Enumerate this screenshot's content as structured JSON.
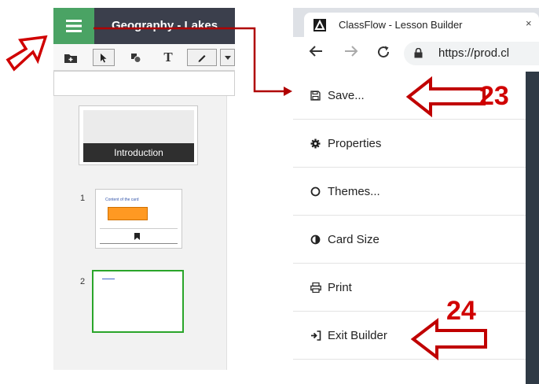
{
  "left_app": {
    "title": "Geography - Lakes",
    "toolbar": {
      "text_tool_label": "T"
    },
    "intro_card": {
      "label": "Introduction"
    },
    "cards": [
      {
        "number": "1",
        "title": "Content of the card"
      },
      {
        "number": "2"
      }
    ]
  },
  "browser": {
    "tab_title": "ClassFlow - Lesson Builder",
    "tab_close": "×",
    "url": "https://prod.cl"
  },
  "menu": {
    "items": [
      {
        "label": "Save...",
        "icon": "floppy-disk-icon"
      },
      {
        "label": "Properties",
        "icon": "gear-icon"
      },
      {
        "label": "Themes...",
        "icon": "circle-outline-icon"
      },
      {
        "label": "Card Size",
        "icon": "half-circle-icon"
      },
      {
        "label": "Print",
        "icon": "printer-icon"
      },
      {
        "label": "Exit Builder",
        "icon": "sign-out-icon"
      }
    ]
  },
  "annotations": {
    "step_a": "23",
    "step_b": "24",
    "color": "#d00000"
  },
  "colors": {
    "hamburger_green": "#4aa364",
    "title_bar": "#3b3f4c",
    "selected_card_border": "#2aa52a",
    "orange_block": "#ff9922"
  }
}
